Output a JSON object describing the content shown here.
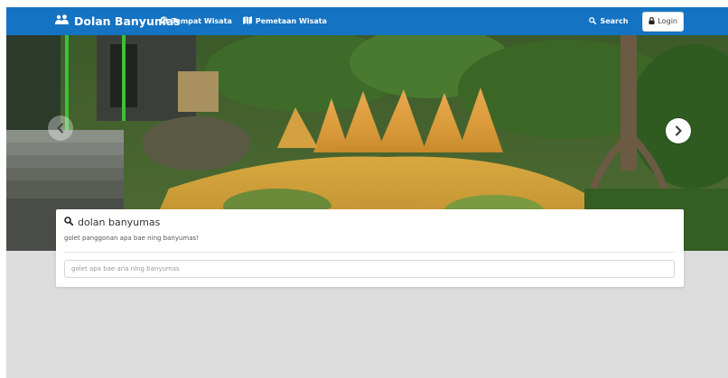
{
  "navbar": {
    "brand": "Dolan Banyumas",
    "brand_icon": "people-icon",
    "links": [
      {
        "label": "Tempat Wisata",
        "icon": "globe-icon"
      },
      {
        "label": "Pemetaan Wisata",
        "icon": "map-icon"
      }
    ],
    "search_label": "Search",
    "login_label": "Login"
  },
  "hero": {
    "prev_icon": "chevron-left-icon",
    "next_icon": "chevron-right-icon"
  },
  "search_panel": {
    "title": "dolan banyumas",
    "subtitle": "golet panggonan apa bae ning banyumas!",
    "input_placeholder": "golet apa bae ana ning banyumas",
    "input_value": ""
  },
  "colors": {
    "navbar": "#1573c3",
    "page_bg": "#dcdcdc"
  }
}
